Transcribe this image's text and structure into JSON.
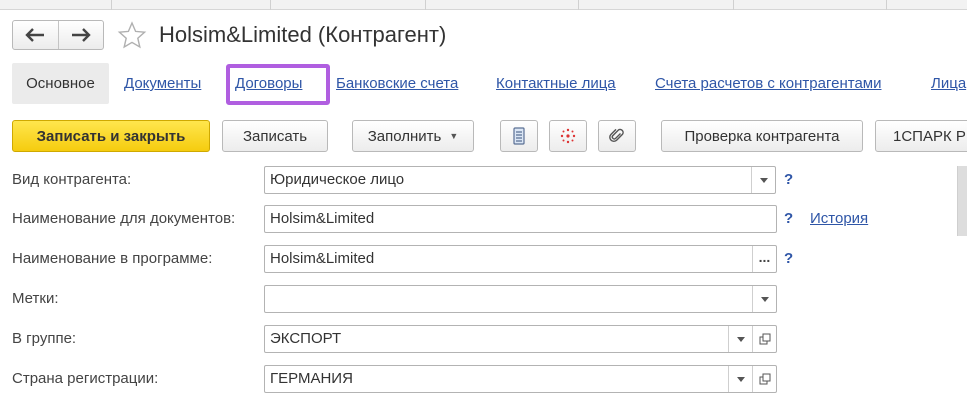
{
  "header": {
    "back_icon": "arrow-left-icon",
    "forward_icon": "arrow-right-icon",
    "favorite_icon": "star-outline-icon",
    "title": "Holsim&Limited (Контрагент)"
  },
  "tabs": {
    "active": "Основное",
    "links": [
      "Документы",
      "Договоры",
      "Банковские счета",
      "Контактные лица",
      "Счета расчетов с контрагентами",
      "Лица"
    ],
    "highlight_color": "#b05ee0"
  },
  "toolbar": {
    "save_close": "Записать и закрыть",
    "save": "Записать",
    "fill": "Заполнить",
    "list_icon": "list-icon",
    "structure_icon": "hierarchy-icon",
    "attach_icon": "paperclip-icon",
    "check": "Проверка контрагента",
    "spark": "1СПАРК Р",
    "primary_color": "#f5cc0f"
  },
  "form": {
    "type_label": "Вид контрагента:",
    "type_value": "Юридическое лицо",
    "docname_label": "Наименование для документов:",
    "docname_value": "Holsim&Limited",
    "history_link": "История",
    "progname_label": "Наименование в программе:",
    "progname_value": "Holsim&Limited",
    "tags_label": "Метки:",
    "tags_value": "",
    "group_label": "В группе:",
    "group_value": "ЭКСПОРТ",
    "country_label": "Страна регистрации:",
    "country_value": "ГЕРМАНИЯ",
    "help": "?",
    "more": "...",
    "link_color": "#2f56a7"
  }
}
